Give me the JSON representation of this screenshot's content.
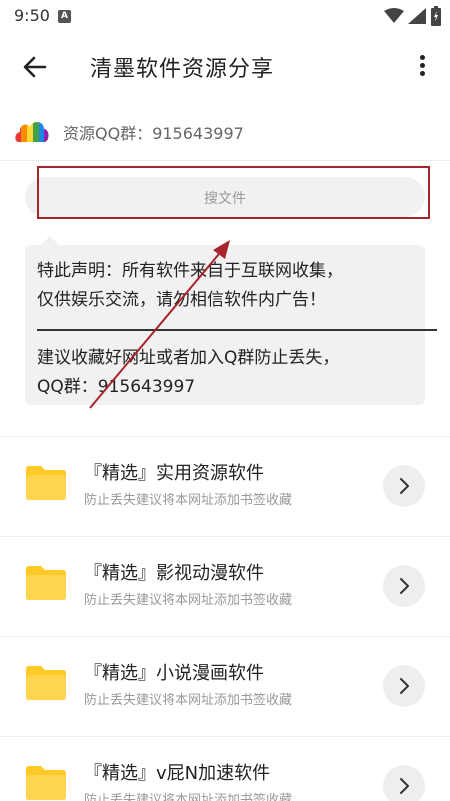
{
  "status_bar": {
    "time": "9:50",
    "notification_icon": "A"
  },
  "app_bar": {
    "title": "清墨软件资源分享",
    "back_icon": "arrow-left-icon",
    "menu_icon": "more-vert-icon"
  },
  "qq_group": {
    "text": "资源QQ群：915643997",
    "icon": "colorful-cloud-icon"
  },
  "search": {
    "placeholder": "搜文件"
  },
  "notice": {
    "line1": "特此声明：所有软件来自于互联网收集，",
    "line2": "仅供娱乐交流，请勿相信软件内广告！",
    "line3": "建议收藏好网址或者加入Q群防止丢失，",
    "line4": "QQ群：915643997"
  },
  "folders": [
    {
      "name": "『精选』实用资源软件",
      "subtitle": "防止丢失建议将本网址添加书签收藏"
    },
    {
      "name": "『精选』影视动漫软件",
      "subtitle": "防止丢失建议将本网址添加书签收藏"
    },
    {
      "name": "『精选』小说漫画软件",
      "subtitle": "防止丢失建议将本网址添加书签收藏"
    },
    {
      "name": "『精选』v屁N加速软件",
      "subtitle": "防止丢失建议将本网址添加书签收藏"
    }
  ],
  "colors": {
    "highlight_box": "#a8242c",
    "folder_yellow": "#ffd54f",
    "folder_tab": "#ffca28"
  }
}
